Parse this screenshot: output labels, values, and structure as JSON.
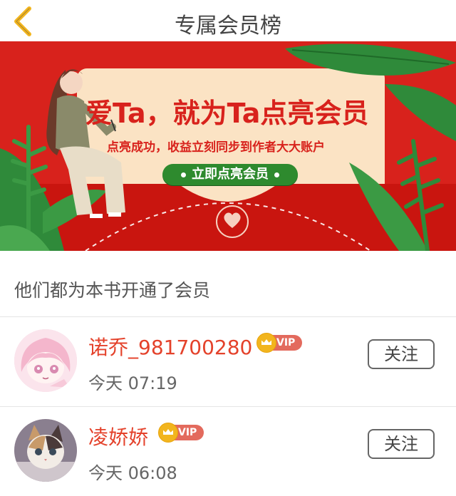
{
  "header": {
    "title": "专属会员榜",
    "back_icon": "chevron-left-icon",
    "accent": "#f2b51e"
  },
  "banner": {
    "headline": "爱Ta，就为Ta点亮会员",
    "subtitle": "点亮成功，收益立刻同步到作者大大账户",
    "button_label": "立即点亮会员",
    "colors": {
      "background": "#d8221c",
      "card": "#fbe3c4",
      "button": "#2e8a2e"
    }
  },
  "list": {
    "section_title": "他们都为本书开通了会员",
    "follow_label": "关注",
    "vip_badge": "VIP",
    "members": [
      {
        "name": "诺乔_981700280",
        "time": "今天 07:19",
        "avatar": "anime-girl-avatar"
      },
      {
        "name": "凌娇娇",
        "time": "今天 06:08",
        "avatar": "kitten-avatar"
      }
    ]
  }
}
